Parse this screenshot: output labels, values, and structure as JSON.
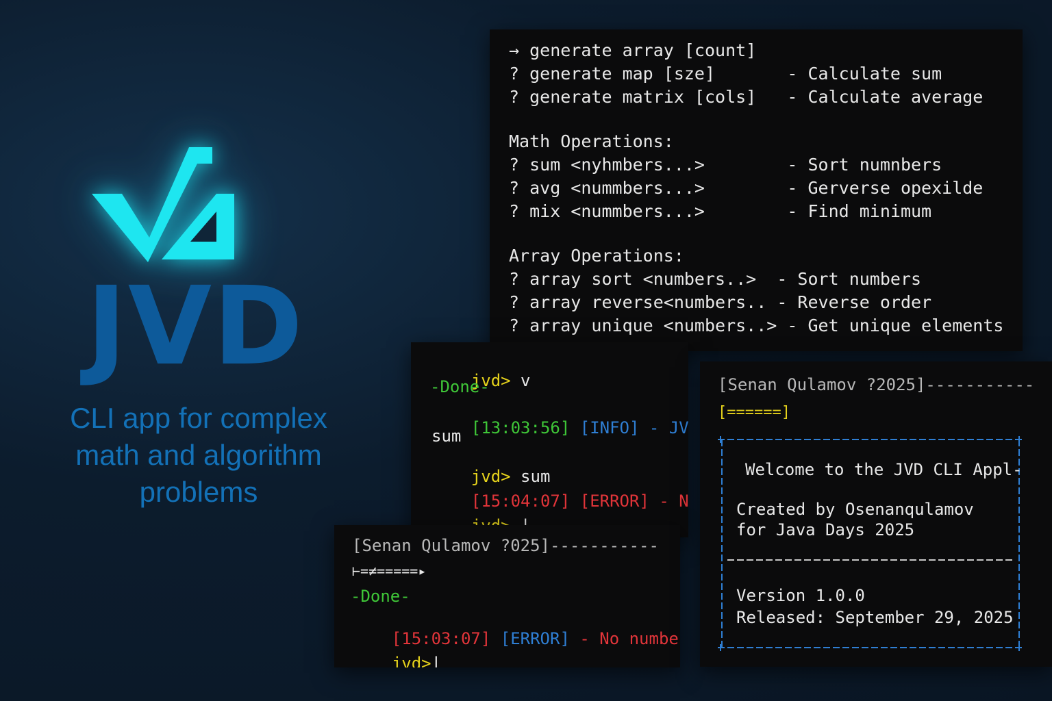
{
  "brand": {
    "name": "JVD",
    "tagline": [
      "CLI app for complex",
      "math and algorithm",
      "problems"
    ],
    "logo_icon": "sqrt-check-icon",
    "accent_color": "#1ee6f0",
    "brand_color": "#0d5a9a"
  },
  "help_terminal": {
    "lines": [
      "→ generate array [count]",
      "? generate map [sze]       - Calculate sum",
      "? generate matrix [cols]   - Calculate average",
      "",
      "Math Operations:",
      "? sum <nyhmbers...>        - Sort numnbers",
      "? avg <nummbers...>        - Gerverse opexilde",
      "? mix <nummbers...>        - Find minimum",
      "",
      "Array Operations:",
      "? array sort <numbers..>  - Sort numbers",
      "? array reverse<numbers.. - Reverse order",
      "? array unique <numbers..> - Get unique elements"
    ]
  },
  "session_terminal": {
    "prompt": "jvd>",
    "cmd1": "v",
    "done": "-Done-",
    "log1_time": "[13:03:56]",
    "log1_level": "[INFO]",
    "log1_msg": "- JVD CLI",
    "echo": "sum",
    "cmd2": "sum",
    "log2_time": "[15:04:07]",
    "log2_level": "[ERROR]",
    "log2_msg": "- No numb",
    "cursor": "|"
  },
  "bottom_terminal": {
    "header": "[Senan Qulamov ?025]-----------",
    "progress": "⊢=≠=====▸",
    "done": "-Done-",
    "log_time": "[15:03:07]",
    "log_level": "[ERROR]",
    "log_msg": "- No number pro",
    "prompt": "jvd>",
    "cursor": "|"
  },
  "welcome_terminal": {
    "header": "[Senan Qulamov ?2025]-----------",
    "progress": "[======]",
    "welcome": "Welcome to the JVD CLI Appl-",
    "created_by": "Created by Osenanqulamov",
    "for_event": "for Java Days 2025",
    "version": "Version 1.0.0",
    "released": "Released: September 29, 2025"
  }
}
